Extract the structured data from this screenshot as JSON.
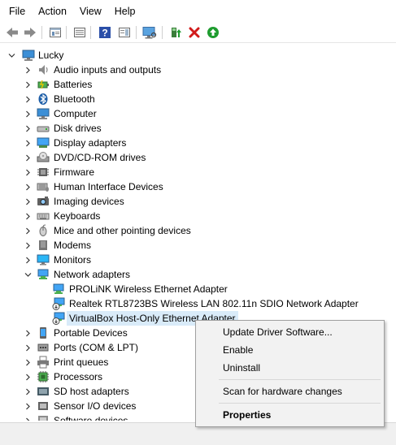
{
  "menubar": {
    "items": [
      "File",
      "Action",
      "View",
      "Help"
    ]
  },
  "toolbar": {
    "buttons": [
      "back-icon",
      "forward-icon",
      "properties-icon",
      "show-hide-console-icon",
      "help-icon",
      "action-pane-icon",
      "scan-hardware-icon",
      "update-driver-icon",
      "uninstall-icon",
      "enable-icon"
    ],
    "colors": {
      "uninstall": "#d11a1a",
      "enable": "#1e9c2f",
      "help": "#2b4fa8"
    }
  },
  "tree": {
    "root": "Lucky",
    "categories": [
      {
        "label": "Audio inputs and outputs",
        "icon": "speaker-icon"
      },
      {
        "label": "Batteries",
        "icon": "battery-icon"
      },
      {
        "label": "Bluetooth",
        "icon": "bluetooth-icon"
      },
      {
        "label": "Computer",
        "icon": "computer-icon"
      },
      {
        "label": "Disk drives",
        "icon": "disk-drive-icon"
      },
      {
        "label": "Display adapters",
        "icon": "display-adapter-icon"
      },
      {
        "label": "DVD/CD-ROM drives",
        "icon": "dvd-drive-icon"
      },
      {
        "label": "Firmware",
        "icon": "firmware-icon"
      },
      {
        "label": "Human Interface Devices",
        "icon": "hid-icon"
      },
      {
        "label": "Imaging devices",
        "icon": "camera-icon"
      },
      {
        "label": "Keyboards",
        "icon": "keyboard-icon"
      },
      {
        "label": "Mice and other pointing devices",
        "icon": "mouse-icon"
      },
      {
        "label": "Modems",
        "icon": "modem-icon"
      },
      {
        "label": "Monitors",
        "icon": "monitor-icon"
      },
      {
        "label": "Network adapters",
        "icon": "network-adapter-icon",
        "expanded": true,
        "children": [
          {
            "label": "PROLiNK Wireless Ethernet Adapter",
            "icon": "network-card-icon"
          },
          {
            "label": "Realtek RTL8723BS Wireless LAN 802.11n SDIO Network Adapter",
            "icon": "network-card-disabled-icon"
          },
          {
            "label": "VirtualBox Host-Only Ethernet Adapter",
            "icon": "network-card-disabled-icon",
            "selected": true
          }
        ]
      },
      {
        "label": "Portable Devices",
        "icon": "portable-device-icon"
      },
      {
        "label": "Ports (COM & LPT)",
        "icon": "port-icon"
      },
      {
        "label": "Print queues",
        "icon": "printer-icon"
      },
      {
        "label": "Processors",
        "icon": "processor-icon"
      },
      {
        "label": "SD host adapters",
        "icon": "sd-card-icon"
      },
      {
        "label": "Sensor I/O devices",
        "icon": "sensor-icon"
      },
      {
        "label": "Software devices",
        "icon": "software-device-icon"
      }
    ]
  },
  "context_menu": {
    "items": [
      {
        "label": "Update Driver Software..."
      },
      {
        "label": "Enable"
      },
      {
        "label": "Uninstall"
      },
      {
        "separator": true
      },
      {
        "label": "Scan for hardware changes"
      },
      {
        "separator": true
      },
      {
        "label": "Properties",
        "bold": true
      }
    ]
  }
}
